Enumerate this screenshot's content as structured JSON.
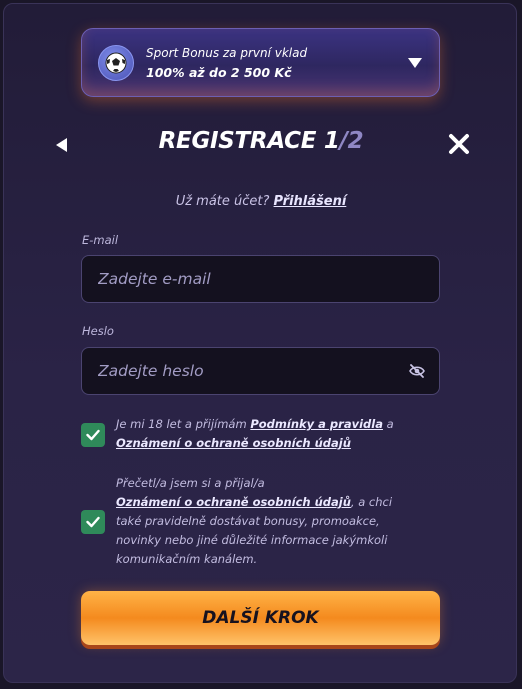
{
  "bonus": {
    "line1": "Sport Bonus za první vklad",
    "line2": "100% až do 2 500 Kč"
  },
  "header": {
    "title_main": "REGISTRACE 1",
    "title_sep": "/",
    "title_total": "2"
  },
  "login": {
    "prompt": "Už máte účet?",
    "link": "Přihlášení"
  },
  "email": {
    "label": "E-mail",
    "placeholder": "Zadejte e-mail"
  },
  "password": {
    "label": "Heslo",
    "placeholder": "Zadejte heslo"
  },
  "consent1": {
    "checked": true,
    "text_a": "Je mi 18 let a přijímám",
    "link_a": "Podmínky a pravidla",
    "text_b": "a",
    "link_b": "Oznámení o ochraně osobních údajů"
  },
  "consent2": {
    "checked": true,
    "text_a": "Přečetl/a jsem si a přijal/a",
    "link_a": "Oznámení o ochraně osobních údajů",
    "text_b": ", a chci také pravidelně dostávat bonusy, promoakce, novinky nebo jiné důležité informace jakýmkoli komunikačním kanálem."
  },
  "next_button": {
    "label": "DALŠÍ KROK"
  },
  "colors": {
    "accent_orange": "#f48a1e",
    "checkbox_green": "#2f8a5a",
    "bonus_purple": "#3b3382"
  }
}
